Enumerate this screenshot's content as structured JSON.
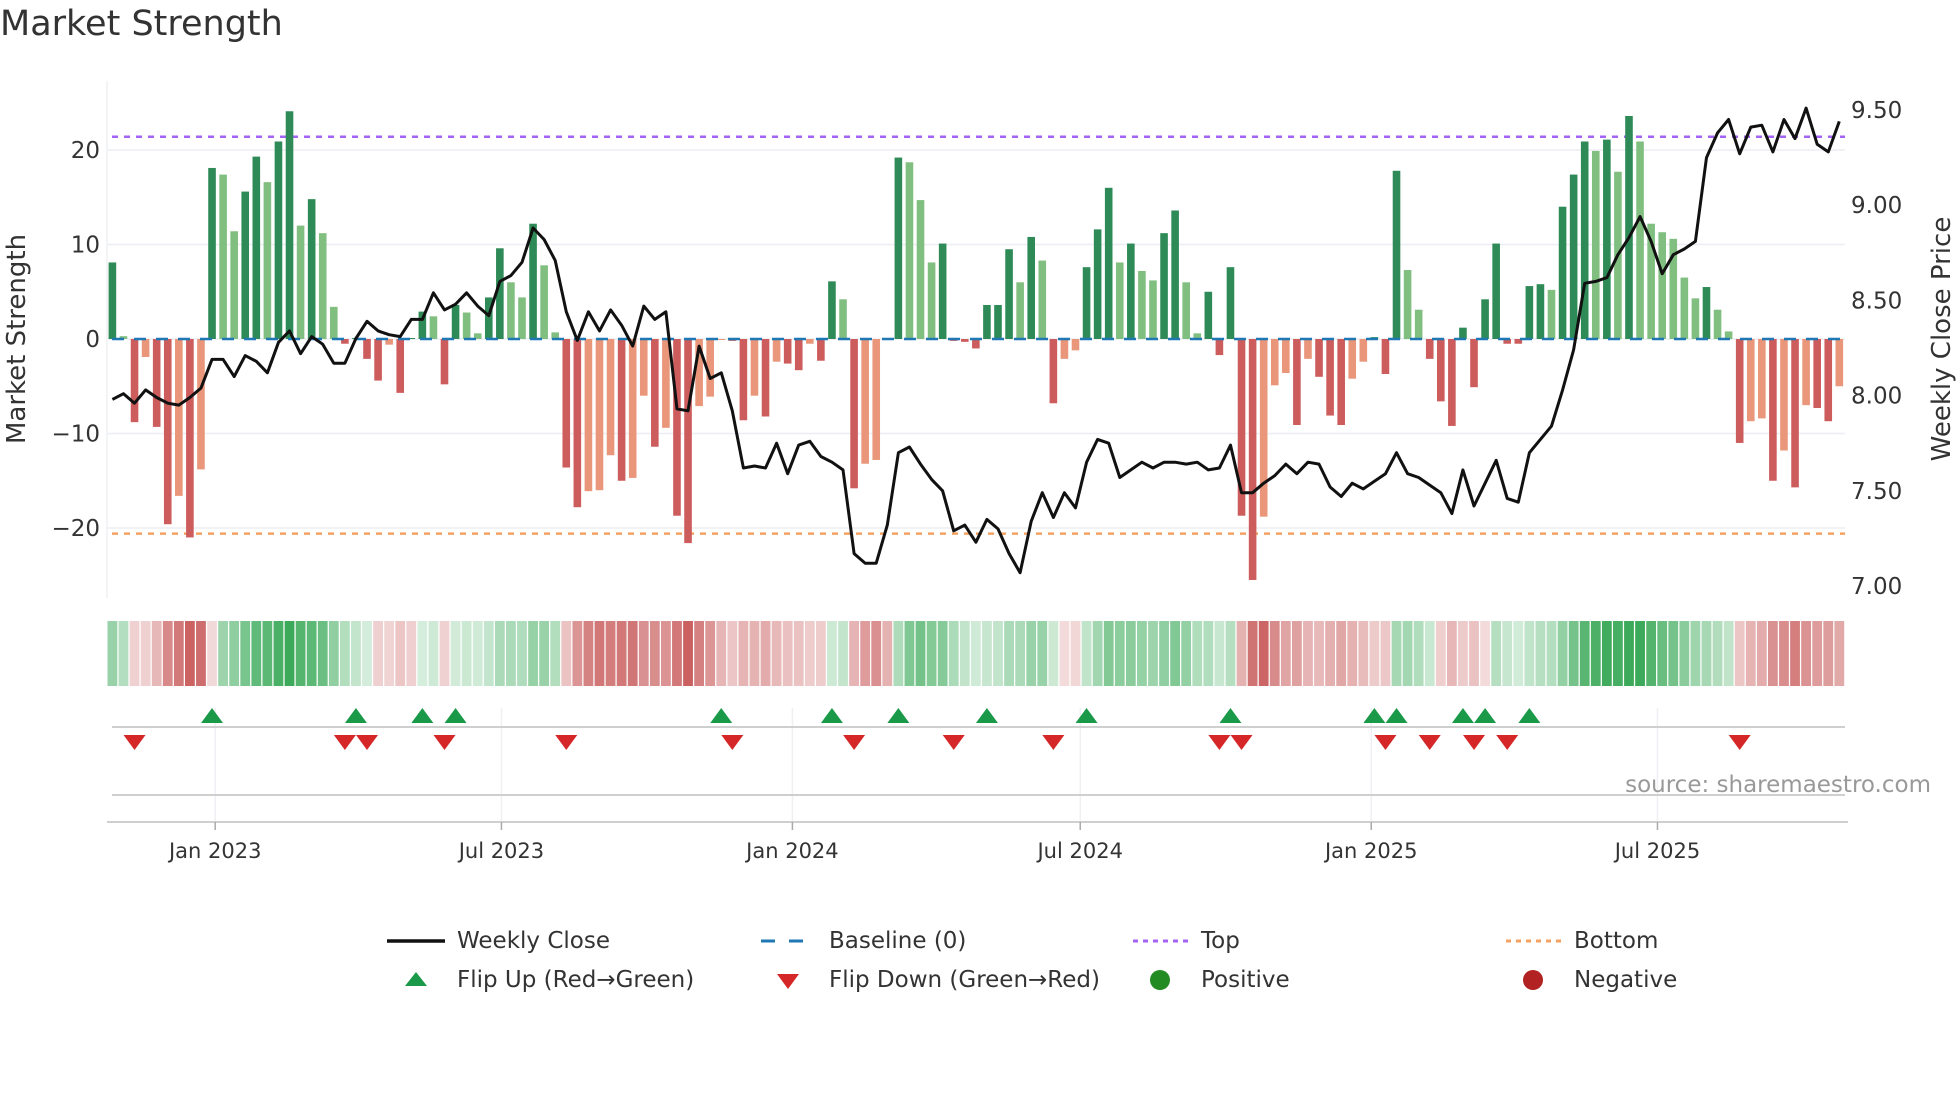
{
  "title": "Market Strength",
  "source": "source: sharemaestro.com",
  "chart_data": {
    "type": "bar",
    "title": "Market Strength",
    "ylabel": "Market Strength",
    "y2label": "Weekly Close Price",
    "start_week": "2022-10-28",
    "frequency": "weekly",
    "ylim": [
      -27.4,
      27.3
    ],
    "y2lim": [
      6.94,
      9.65
    ],
    "yticks": [
      -20,
      -10,
      0,
      10,
      20
    ],
    "ytick_labels": [
      "−20",
      "−10",
      "0",
      "10",
      "20"
    ],
    "y2ticks": [
      7.0,
      7.5,
      8.0,
      8.5,
      9.0,
      9.5
    ],
    "y2tick_labels": [
      "7.00",
      "7.50",
      "8.00",
      "8.50",
      "9.00",
      "9.50"
    ],
    "xticks": [
      {
        "date": "2023-01-01",
        "label": "Jan 2023"
      },
      {
        "date": "2023-07-01",
        "label": "Jul 2023"
      },
      {
        "date": "2024-01-01",
        "label": "Jan 2024"
      },
      {
        "date": "2024-07-01",
        "label": "Jul 2024"
      },
      {
        "date": "2025-01-01",
        "label": "Jan 2025"
      },
      {
        "date": "2025-07-01",
        "label": "Jul 2025"
      }
    ],
    "top_level": 21.4,
    "bottom_level": -20.6,
    "baseline": 0,
    "strength": [
      8.1,
      0.3,
      -8.8,
      -1.9,
      -9.3,
      -19.6,
      -16.6,
      -21.0,
      -13.8,
      18.1,
      17.4,
      11.4,
      15.6,
      19.3,
      16.6,
      20.9,
      24.1,
      12.0,
      14.8,
      11.2,
      3.4,
      -0.5,
      0.1,
      -2.1,
      -4.4,
      -0.6,
      -5.7,
      0.1,
      2.9,
      2.4,
      -4.8,
      3.6,
      2.8,
      0.6,
      4.4,
      9.6,
      6.0,
      4.4,
      12.2,
      7.8,
      0.7,
      -13.6,
      -17.8,
      -16.1,
      -16.0,
      -12.3,
      -15.0,
      -14.7,
      -6.0,
      -11.4,
      -9.4,
      -18.7,
      -21.6,
      -7.1,
      -6.1,
      -0.1,
      -0.2,
      -8.6,
      -6.0,
      -8.2,
      -2.4,
      -2.6,
      -3.3,
      -0.5,
      -2.3,
      6.1,
      4.2,
      -15.8,
      -13.2,
      -12.8,
      0.1,
      19.2,
      18.7,
      14.7,
      8.1,
      10.1,
      -0.2,
      -0.3,
      -1.0,
      3.6,
      3.6,
      9.5,
      6.0,
      10.8,
      8.3,
      -6.8,
      -2.1,
      -1.2,
      7.6,
      11.6,
      16.0,
      8.1,
      10.1,
      7.2,
      6.2,
      11.2,
      13.6,
      6.0,
      0.6,
      5.0,
      -1.7,
      7.6,
      -18.7,
      -25.5,
      -18.8,
      -4.9,
      -3.6,
      -9.1,
      -2.1,
      -4.0,
      -8.1,
      -9.1,
      -4.2,
      -2.4,
      0.2,
      -3.7,
      17.8,
      7.3,
      3.1,
      -2.1,
      -6.6,
      -9.2,
      1.2,
      -5.1,
      4.2,
      10.1,
      -0.5,
      -0.5,
      5.6,
      5.8,
      5.2,
      14.0,
      17.4,
      20.9,
      19.9,
      21.1,
      17.7,
      23.6,
      20.9,
      12.2,
      11.3,
      10.6,
      6.5,
      4.3,
      5.5,
      3.1,
      0.8,
      -11.0,
      -8.7,
      -8.4,
      -15.0,
      -11.8,
      -15.7,
      -7.0,
      -7.3,
      -8.7,
      -5.0
    ],
    "weekly_close": [
      7.98,
      8.01,
      7.96,
      8.03,
      7.99,
      7.96,
      7.95,
      7.99,
      8.04,
      8.19,
      8.19,
      8.1,
      8.21,
      8.18,
      8.12,
      8.28,
      8.34,
      8.22,
      8.31,
      8.27,
      8.17,
      8.17,
      8.3,
      8.39,
      8.34,
      8.32,
      8.31,
      8.4,
      8.4,
      8.54,
      8.45,
      8.48,
      8.54,
      8.47,
      8.42,
      8.6,
      8.63,
      8.7,
      8.88,
      8.82,
      8.71,
      8.44,
      8.29,
      8.44,
      8.34,
      8.45,
      8.37,
      8.26,
      8.47,
      8.4,
      8.44,
      7.93,
      7.92,
      8.26,
      8.09,
      8.12,
      7.92,
      7.62,
      7.63,
      7.62,
      7.75,
      7.59,
      7.74,
      7.76,
      7.68,
      7.65,
      7.61,
      7.17,
      7.12,
      7.12,
      7.32,
      7.7,
      7.73,
      7.64,
      7.56,
      7.5,
      7.29,
      7.32,
      7.23,
      7.35,
      7.3,
      7.17,
      7.07,
      7.34,
      7.49,
      7.36,
      7.49,
      7.41,
      7.65,
      7.77,
      7.75,
      7.57,
      7.61,
      7.65,
      7.62,
      7.65,
      7.65,
      7.64,
      7.65,
      7.61,
      7.62,
      7.74,
      7.49,
      7.49,
      7.54,
      7.58,
      7.64,
      7.59,
      7.65,
      7.64,
      7.52,
      7.47,
      7.54,
      7.51,
      7.55,
      7.59,
      7.7,
      7.59,
      7.57,
      7.53,
      7.49,
      7.38,
      7.61,
      7.42,
      7.54,
      7.66,
      7.46,
      7.44,
      7.7,
      7.77,
      7.84,
      8.03,
      8.24,
      8.59,
      8.6,
      8.62,
      8.74,
      8.83,
      8.94,
      8.81,
      8.64,
      8.74,
      8.77,
      8.81,
      9.25,
      9.38,
      9.45,
      9.27,
      9.41,
      9.42,
      9.28,
      9.45,
      9.35,
      9.51,
      9.32,
      9.28,
      9.44
    ],
    "flip_up_weeks": [
      10,
      23,
      29,
      32,
      56,
      66,
      72,
      80,
      89,
      102,
      115,
      117,
      123,
      125,
      129
    ],
    "flip_down_weeks": [
      3,
      22,
      24,
      31,
      42,
      57,
      68,
      77,
      86,
      101,
      103,
      116,
      120,
      124,
      127,
      148
    ],
    "colors": {
      "rising_positive": "#2e8b57",
      "falling_positive": "#80bf80",
      "falling_negative": "#cd5c5c",
      "rising_negative": "#e9967a",
      "weekly_close": "#111111",
      "baseline": "#1f77b4",
      "top": "#a463f2",
      "bottom": "#f4a261",
      "flip_up": "#1a9a48",
      "flip_down": "#d62728",
      "positive": "#228b22",
      "negative": "#b22222"
    },
    "legend": {
      "placement": "bottom-center",
      "entries": [
        {
          "label": "Weekly Close",
          "icon": "solid-line"
        },
        {
          "label": "Baseline (0)",
          "icon": "dashed-line"
        },
        {
          "label": "Top",
          "icon": "dotted-line"
        },
        {
          "label": "Bottom",
          "icon": "dotted-line"
        },
        {
          "label": "Flip Up (Red→Green)",
          "icon": "triangle-up"
        },
        {
          "label": "Flip Down (Green→Red)",
          "icon": "triangle-down"
        },
        {
          "label": "Positive",
          "icon": "circle"
        },
        {
          "label": "Negative",
          "icon": "circle"
        }
      ]
    }
  }
}
